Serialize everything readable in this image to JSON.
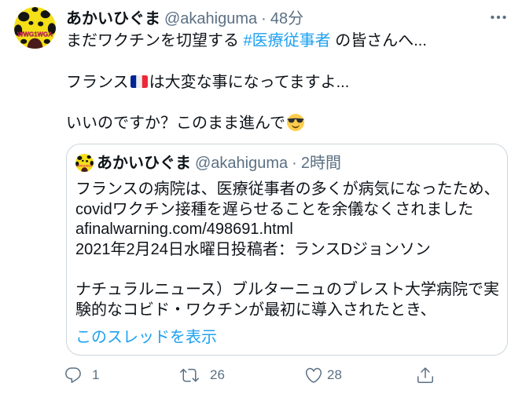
{
  "tweet": {
    "author": {
      "display_name": "あかいひぐま",
      "handle": "@akahiguma",
      "separator": "·",
      "timestamp": "48分",
      "avatar_lettering": "WWG1WGA"
    },
    "more_icon": "more-horizontal-icon",
    "body": {
      "line1": {
        "text_before": "まだワクチンを切望する ",
        "hashtag": "#医療従事者",
        "text_after": " の皆さんへ..."
      },
      "line2": {
        "text_before": "フランス",
        "emoji": "france-flag-icon",
        "text_after": "は大変な事になってますよ..."
      },
      "line3": {
        "text_before": "いいのですか？このまま進んで",
        "emoji": "smiling-face-with-sunglasses-icon"
      }
    },
    "quoted_tweet": {
      "author": {
        "display_name": "あかいひぐま",
        "handle": "@akahiguma",
        "separator": "·",
        "timestamp": "2時間"
      },
      "lines": [
        "フランスの病院は、医療従事者の多くが病気になったため、",
        "covidワクチン接種を遅らせることを余儀なくされました",
        "afinalwarning.com/498691.html",
        "2021年2月24日水曜日投稿者：ランスDジョンソン",
        "ナチュラルニュース）ブルターニュのブレスト大学病院で実",
        "験的なコビド・ワクチンが最初に導入されたとき、"
      ],
      "show_thread_link": "このスレッドを表示"
    },
    "actions": {
      "reply": {
        "icon": "reply-icon",
        "count": "1"
      },
      "retweet": {
        "icon": "retweet-icon",
        "count": "26"
      },
      "like": {
        "icon": "heart-icon",
        "count": "28"
      },
      "share": {
        "icon": "share-icon"
      }
    }
  },
  "colors": {
    "text": "#0f1419",
    "muted": "#5b7083",
    "link": "#1da1f2",
    "border": "#ccd6dd",
    "bg": "#ffffff"
  }
}
